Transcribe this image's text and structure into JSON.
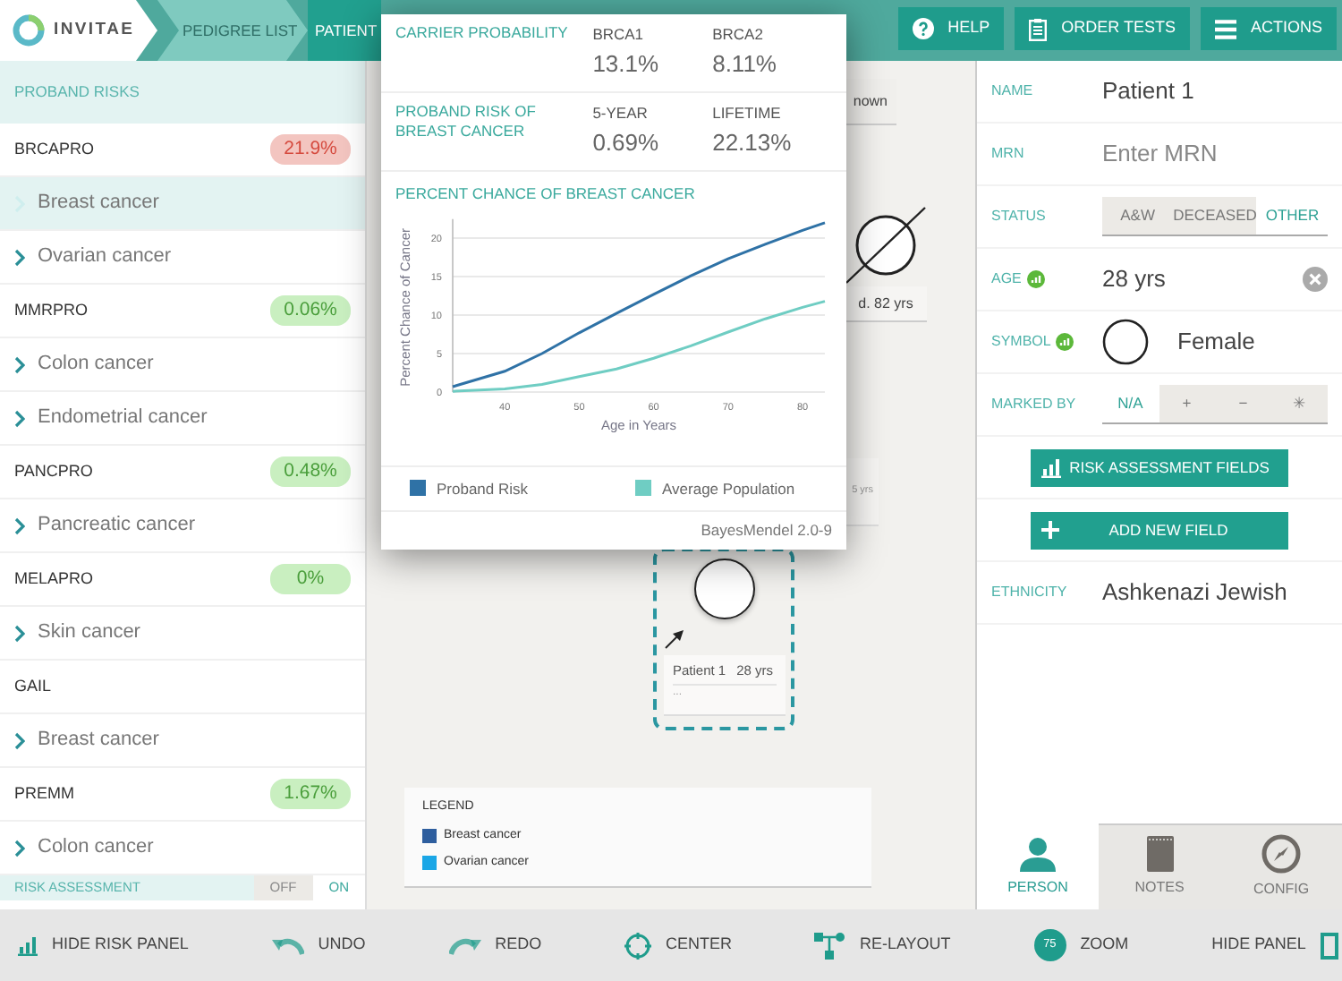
{
  "topbar": {
    "logo_text": "INVITAE",
    "breadcrumbs": [
      {
        "label": "PEDIGREE LIST",
        "selected": false
      },
      {
        "label": "PATIENT",
        "selected": true
      }
    ],
    "buttons": [
      {
        "label": "HELP"
      },
      {
        "label": "ORDER TESTS"
      },
      {
        "label": "ACTIONS"
      }
    ]
  },
  "risk_panel": {
    "title": "PROBAND RISKS",
    "models": [
      {
        "name": "BRCAPRO",
        "risk": "21.9%",
        "alert": true,
        "cancers": [
          {
            "label": "Breast cancer",
            "selected": true
          },
          {
            "label": "Ovarian cancer",
            "selected": false
          }
        ]
      },
      {
        "name": "MMRPRO",
        "risk": "0.06%",
        "alert": false,
        "cancers": [
          {
            "label": "Colon cancer",
            "selected": false
          },
          {
            "label": "Endometrial cancer",
            "selected": false
          }
        ]
      },
      {
        "name": "PANCPRO",
        "risk": "0.48%",
        "alert": false,
        "cancers": [
          {
            "label": "Pancreatic cancer",
            "selected": false
          }
        ]
      },
      {
        "name": "MELAPRO",
        "risk": "0%",
        "alert": false,
        "cancers": [
          {
            "label": "Skin cancer",
            "selected": false
          }
        ]
      },
      {
        "name": "GAIL",
        "cancers": [
          {
            "label": "Breast cancer",
            "selected": false
          }
        ]
      },
      {
        "name": "PREMM",
        "risk": "1.67%",
        "alert": false,
        "cancers": [
          {
            "label": "Colon cancer",
            "selected": false
          }
        ]
      }
    ],
    "risk_assessment": {
      "label": "RISK ASSESSMENT",
      "options": [
        {
          "label": "OFF",
          "selected": false
        },
        {
          "label": "ON",
          "selected": true
        }
      ]
    }
  },
  "popover": {
    "sections": [
      {
        "label": "CARRIER PROBABILITY",
        "stats": [
          {
            "label": "BRCA1",
            "value": "13.1%"
          },
          {
            "label": "BRCA2",
            "value": "8.11%"
          }
        ]
      },
      {
        "label": "PROBAND RISK OF BREAST CANCER",
        "stats": [
          {
            "label": "5-YEAR",
            "value": "0.69%"
          },
          {
            "label": "LIFETIME",
            "value": "22.13%"
          }
        ]
      }
    ],
    "chart_data": {
      "type": "line",
      "title": "PERCENT CHANCE OF BREAST CANCER",
      "xlabel": "Age in Years",
      "ylabel": "Percent Chance of Cancer",
      "x": [
        33,
        40,
        45,
        50,
        55,
        60,
        65,
        70,
        75,
        80,
        83
      ],
      "series": [
        {
          "name": "Proband Risk",
          "color": "#2f72a6",
          "values": [
            0.7,
            2.7,
            5,
            7.7,
            10.2,
            12.7,
            15.1,
            17.3,
            19.2,
            21,
            22
          ]
        },
        {
          "name": "Average Population",
          "color": "#6fcdc3",
          "values": [
            0.1,
            0.4,
            1,
            2,
            3,
            4.4,
            6,
            7.8,
            9.5,
            11,
            11.8
          ]
        }
      ],
      "xlim": [
        33,
        83
      ],
      "ylim": [
        0,
        22
      ],
      "grid": true,
      "xticks": [
        40,
        50,
        60,
        70,
        80
      ],
      "yticks": [
        0,
        5,
        10,
        15,
        20
      ]
    },
    "footer": "BayesMendel 2.0-9"
  },
  "pedigree": {
    "nodes": [
      {
        "kind": "fragment",
        "label": "nown"
      },
      {
        "kind": "deceased",
        "label": "d. 82 yrs"
      },
      {
        "kind": "label-fragment",
        "label": "5 yrs"
      },
      {
        "kind": "proband",
        "name": "Patient 1",
        "age": "28 yrs",
        "note": "...",
        "selected": true
      }
    ],
    "legend": {
      "title": "LEGEND",
      "items": [
        {
          "label": "Breast cancer",
          "color": "#2e5e9e"
        },
        {
          "label": "Ovarian cancer",
          "color": "#1aa6e6"
        }
      ]
    }
  },
  "person": {
    "fields": [
      {
        "kind": "text",
        "label": "NAME",
        "value": "Patient 1"
      },
      {
        "kind": "input",
        "label": "MRN",
        "placeholder": "Enter MRN"
      },
      {
        "kind": "segmented",
        "label": "STATUS",
        "options": [
          {
            "label": "A&W",
            "selected": false
          },
          {
            "label": "DECEASED",
            "selected": false
          },
          {
            "label": "OTHER",
            "selected": true
          }
        ]
      },
      {
        "kind": "clearable",
        "label": "AGE",
        "risk_factor": true,
        "value": "28 yrs"
      },
      {
        "kind": "symbol",
        "label": "SYMBOL",
        "risk_factor": true,
        "value": "Female"
      },
      {
        "kind": "segmented",
        "label": "MARKED BY",
        "options": [
          {
            "label": "N/A",
            "selected": true
          },
          {
            "label": "+",
            "selected": false
          },
          {
            "label": "−",
            "selected": false
          },
          {
            "label": "✳",
            "selected": false
          }
        ]
      },
      {
        "kind": "button",
        "label": "RISK ASSESSMENT FIELDS"
      },
      {
        "kind": "button",
        "label": "ADD NEW FIELD"
      },
      {
        "kind": "text",
        "label": "ETHNICITY",
        "value": "Ashkenazi Jewish"
      }
    ],
    "tabs": [
      {
        "label": "PERSON",
        "selected": true
      },
      {
        "label": "NOTES",
        "selected": false
      },
      {
        "label": "CONFIG",
        "selected": false
      }
    ]
  },
  "toolbar": [
    {
      "label": "HIDE RISK PANEL"
    },
    {
      "label": "UNDO"
    },
    {
      "label": "REDO"
    },
    {
      "label": "CENTER"
    },
    {
      "label": "RE-LAYOUT"
    },
    {
      "label": "ZOOM",
      "badge": "75"
    },
    {
      "label": "HIDE PANEL"
    }
  ]
}
